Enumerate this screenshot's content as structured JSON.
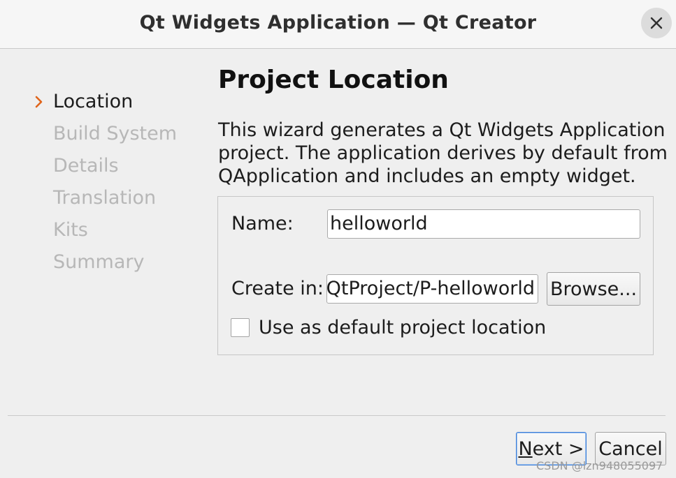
{
  "window": {
    "title": "Qt Widgets Application — Qt Creator"
  },
  "sidebar": {
    "steps": [
      {
        "label": "Location",
        "active": true
      },
      {
        "label": "Build System",
        "active": false
      },
      {
        "label": "Details",
        "active": false
      },
      {
        "label": "Translation",
        "active": false
      },
      {
        "label": "Kits",
        "active": false
      },
      {
        "label": "Summary",
        "active": false
      }
    ]
  },
  "main": {
    "title": "Project Location",
    "description_lines": [
      "This wizard generates a Qt Widgets Application",
      "project. The application derives by default from",
      "QApplication and includes an empty widget."
    ],
    "name_label": "Name:",
    "name_value": "helloworld",
    "create_in_label": "Create in:",
    "create_in_value": "QtProject/P-helloworld",
    "browse_label": "Browse...",
    "default_location_label": "Use as default project location",
    "default_location_checked": false
  },
  "footer": {
    "next_mnemonic": "N",
    "next_rest": "ext >",
    "cancel_label": "Cancel"
  },
  "watermark": "CSDN @lzn948055097",
  "colors": {
    "active_arrow": "#e0641b",
    "inactive_step": "#b7b7b7",
    "focus_border": "#3d7ed8"
  },
  "icons": {
    "close": "close-icon",
    "step_arrow": "chevron-right-icon"
  }
}
